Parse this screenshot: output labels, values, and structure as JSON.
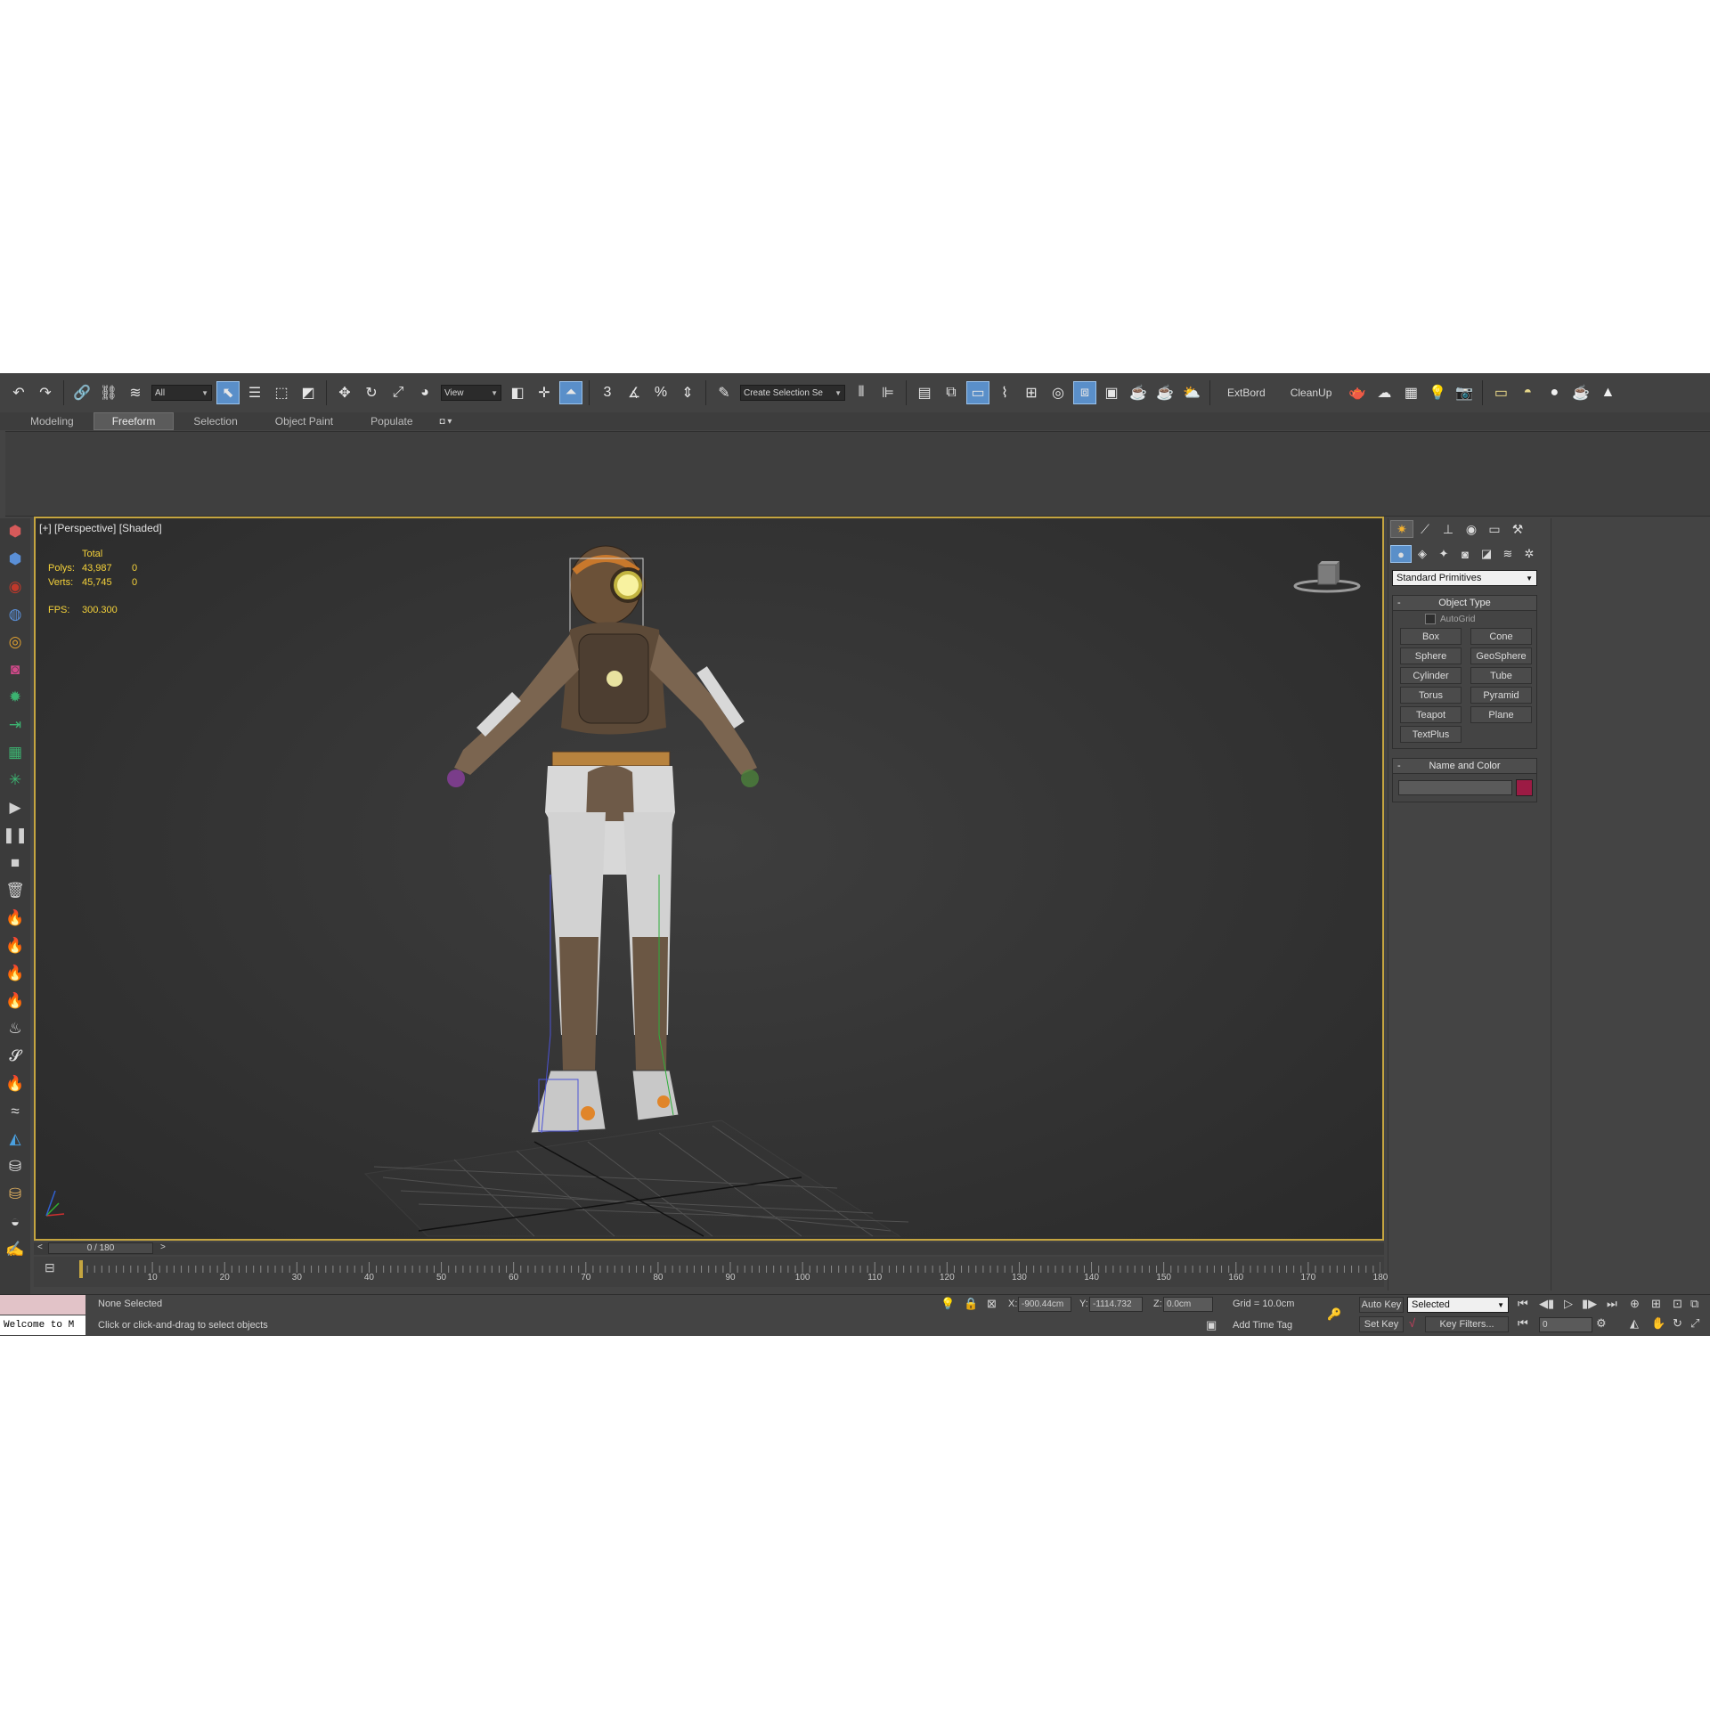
{
  "toolbar": {
    "selection_filter": "All",
    "ref_coord": "View",
    "named_selection_placeholder": "Create Selection Se",
    "snap_label": "3",
    "extra_buttons": [
      "ExtBord",
      "CleanUp"
    ]
  },
  "ribbon": {
    "tabs": [
      "Modeling",
      "Freeform",
      "Selection",
      "Object Paint",
      "Populate"
    ],
    "active_tab": "Freeform"
  },
  "viewport": {
    "label": "[+] [Perspective] [Shaded]",
    "stats": {
      "total_label": "Total",
      "polys_label": "Polys:",
      "polys_total": "43,987",
      "polys_selected": "0",
      "verts_label": "Verts:",
      "verts_total": "45,745",
      "verts_selected": "0",
      "fps_label": "FPS:",
      "fps_value": "300.300"
    },
    "stats_color": "#f5d23a",
    "border_color": "#c5a540"
  },
  "command_panel": {
    "category_dropdown": "Standard Primitives",
    "object_type_title": "Object Type",
    "autogrid_label": "AutoGrid",
    "objects": [
      "Box",
      "Cone",
      "Sphere",
      "GeoSphere",
      "Cylinder",
      "Tube",
      "Torus",
      "Pyramid",
      "Teapot",
      "Plane",
      "TextPlus"
    ],
    "name_color_title": "Name and Color",
    "object_color": "#9c1b44"
  },
  "timeline": {
    "frame_display": "0 / 180",
    "prev_arrow": "<",
    "next_arrow": ">",
    "ticks": [
      "10",
      "20",
      "30",
      "40",
      "50",
      "60",
      "70",
      "80",
      "90",
      "100",
      "110",
      "120",
      "130",
      "140",
      "150",
      "160",
      "170",
      "180"
    ]
  },
  "status": {
    "maxscript_text": "Welcome to M",
    "selection_status": "None Selected",
    "prompt": "Click or click-and-drag to select objects",
    "x_label": "X:",
    "x_value": "-900.44cm",
    "y_label": "Y:",
    "y_value": "-1114.732",
    "z_label": "Z:",
    "z_value": "0.0cm",
    "grid": "Grid = 10.0cm",
    "add_time_tag": "Add Time Tag",
    "auto_key": "Auto Key",
    "set_key": "Set Key",
    "key_mode": "Selected",
    "key_filters": "Key Filters...",
    "current_frame": "0"
  }
}
